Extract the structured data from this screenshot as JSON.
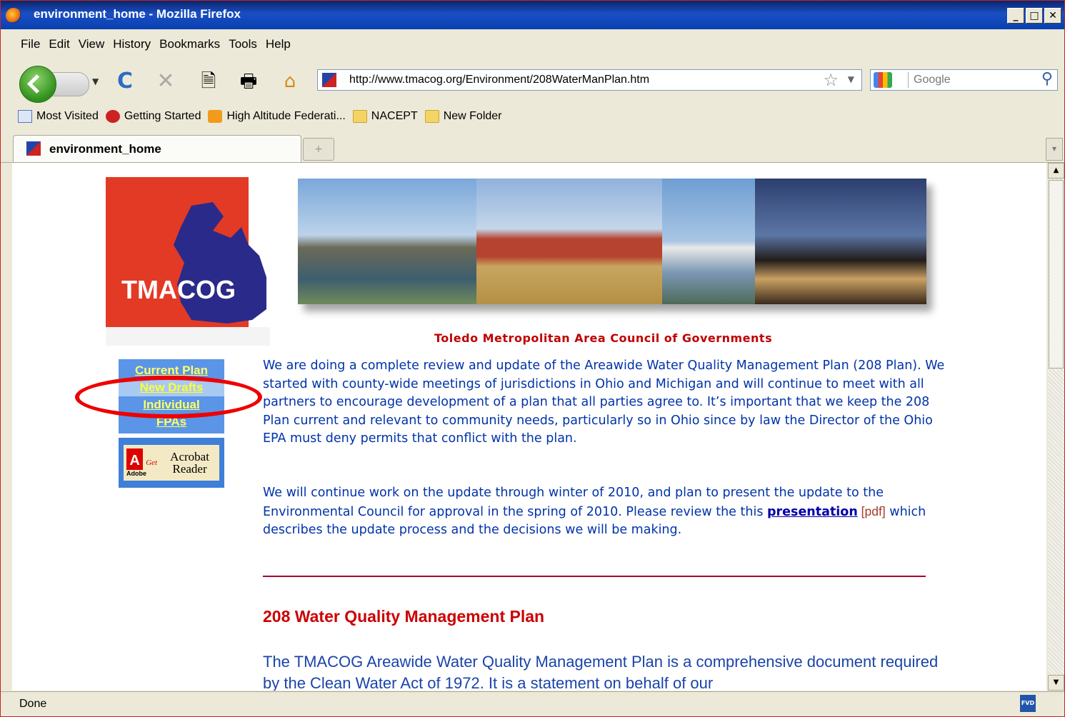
{
  "window": {
    "title": "environment_home - Mozilla Firefox",
    "controls": [
      "_",
      "□",
      "✕"
    ]
  },
  "menu": [
    "File",
    "Edit",
    "View",
    "History",
    "Bookmarks",
    "Tools",
    "Help"
  ],
  "toolbar": {
    "url": "http://www.tmacog.org/Environment/208WaterManPlan.htm",
    "search_placeholder": "Google"
  },
  "bookmarks": [
    {
      "label": "Most Visited",
      "icon": "most-visited-icon"
    },
    {
      "label": "Getting Started",
      "icon": "getting-started-icon"
    },
    {
      "label": "High Altitude Federati...",
      "icon": "rss-feed-icon"
    },
    {
      "label": "NACEPT",
      "icon": "folder-icon"
    },
    {
      "label": "New Folder",
      "icon": "folder-icon"
    }
  ],
  "tab": {
    "label": "environment_home",
    "new_tab": "+"
  },
  "status": {
    "text": "Done"
  },
  "page": {
    "logo_text": "TMACOG",
    "tagline": "Toledo Metropolitan Area Council of Governments",
    "nav": [
      "Current Plan",
      "New Drafts",
      "Individual",
      "FPAs"
    ],
    "acrobat": {
      "adobe": "Adobe",
      "get": "Get",
      "reader": "Acrobat Reader"
    },
    "para1": "We are doing a complete review and update of the Areawide Water Quality Management Plan (208 Plan). We started with county-wide meetings of jurisdictions in Ohio and Michigan and will continue to meet with all partners to encourage development of a plan that all parties agree to. It’s important that we keep the 208 Plan current and relevant to community needs, particularly so in Ohio since by law the Director of the Ohio EPA must deny permits that conflict with the plan.",
    "para2_pre": "We will continue work on the update through winter of 2010, and plan to present the update to the Environmental Council for approval in the spring of 2010. Please review the this ",
    "para2_link": "presentation",
    "para2_pdf": " [pdf]",
    "para2_post": " which describes the update process and the decisions we will be making.",
    "heading": "208 Water Quality Management Plan",
    "para3": "The TMACOG Areawide Water Quality Management Plan is a comprehensive document required by the Clean Water Act of 1972. It is a statement on behalf of our"
  }
}
